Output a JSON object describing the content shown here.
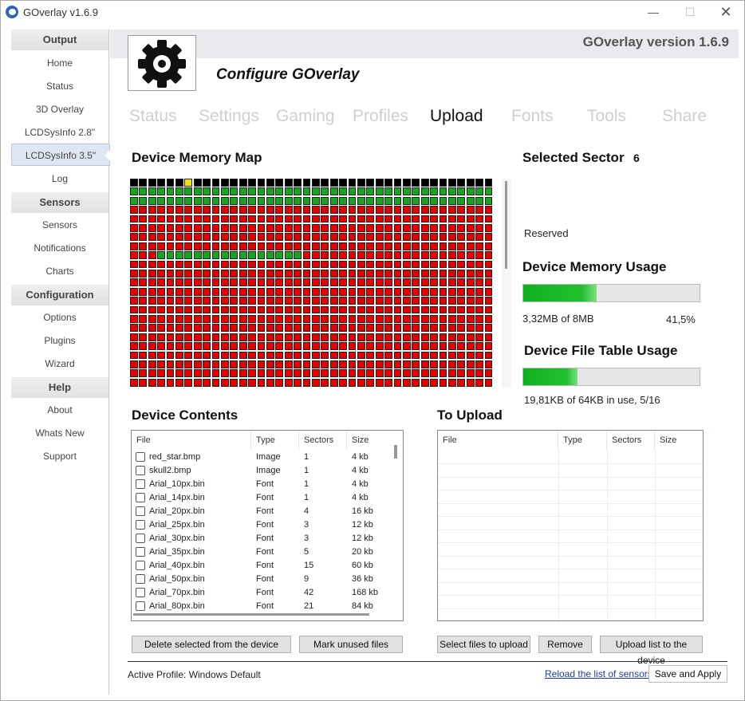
{
  "window": {
    "title": "GOverlay v1.6.9",
    "min_glyph": "—",
    "max_glyph": "☐",
    "close_glyph": "✕"
  },
  "sidebar": {
    "sections": [
      {
        "header": "Output",
        "items": [
          "Home",
          "Status",
          "3D Overlay",
          "LCDSysInfo 2.8\"",
          "LCDSysInfo 3.5\"",
          "Log"
        ]
      },
      {
        "header": "Sensors",
        "items": [
          "Sensors",
          "Notifications",
          "Charts"
        ]
      },
      {
        "header": "Configuration",
        "items": [
          "Options",
          "Plugins",
          "Wizard"
        ]
      },
      {
        "header": "Help",
        "items": [
          "About",
          "Whats New",
          "Support"
        ]
      }
    ],
    "active_item": "LCDSysInfo 3.5\""
  },
  "header": {
    "version": "GOverlay version 1.6.9",
    "configure": "Configure GOverlay",
    "logo_icon": "gear-icon"
  },
  "tabs": [
    {
      "label": "Status",
      "active": false
    },
    {
      "label": "Settings",
      "active": false
    },
    {
      "label": "Gaming",
      "active": false
    },
    {
      "label": "Profiles",
      "active": false
    },
    {
      "label": "Upload",
      "active": true
    },
    {
      "label": "Fonts",
      "active": false
    },
    {
      "label": "Tools",
      "active": false
    },
    {
      "label": "Share",
      "active": false
    }
  ],
  "memory_map": {
    "title": "Device Memory Map",
    "columns": 40,
    "rows_visible": 23,
    "colors": {
      "free": "#16a51d",
      "used": "#e60000",
      "reserved": "#000000",
      "selected": "#f2e600"
    },
    "row_states": [
      "KKKKKKKKKKKKKKKKKKKKKKKKKKKKKKKKKKKKKKKK",
      "GGGGGGGGGGGGGGGGGGGGGGGGGGGGGGGGGGGGGGGG",
      "GGGGGGGGGGGGGGGGGGGGGGGGGGGGGGGGGGGGGGGG",
      "RRRRRRRRRRRRRRRRRRRRRRRRRRRRRRRRRRRRRRRR",
      "RRRRRRRRRRRRRRRRRRRRRRRRRRRRRRRRRRRRRRRR",
      "RRRRRRRRRRRRRRRRRRRRRRRRRRRRRRRRRRRRRRRR",
      "RRRRRRRRRRRRRRRRRRRRRRRRRRRRRRRRRRRRRRRR",
      "RRRRRRRRRRRRRRRRRRRRRRRRRRRRRRRRRRRRRRRR",
      "RRRGGGGGGGGGGGGGGGGRRRRRRRRRRRRRRRRRRRRR",
      "RRRRRRRRRRRRRRRRRRRRRRRRRRRRRRRRRRRRRRRR"
    ]
  },
  "selected_sector": {
    "label": "Selected Sector",
    "value": "6",
    "status": "Reserved"
  },
  "memory_usage": {
    "title": "Device Memory Usage",
    "text": "3,32MB of 8MB",
    "percent_text": "41,5%",
    "fraction": 0.415
  },
  "file_table_usage": {
    "title": "Device File Table Usage",
    "text": "19,81KB of 64KB in use, 5/16",
    "fraction": 0.3095
  },
  "device_contents": {
    "title": "Device Contents",
    "columns": [
      "File",
      "Type",
      "Sectors",
      "Size"
    ],
    "rows": [
      {
        "file": "red_star.bmp",
        "type": "Image",
        "sectors": "1",
        "size": "4 kb"
      },
      {
        "file": "skull2.bmp",
        "type": "Image",
        "sectors": "1",
        "size": "4 kb"
      },
      {
        "file": "Arial_10px.bin",
        "type": "Font",
        "sectors": "1",
        "size": "4 kb"
      },
      {
        "file": "Arial_14px.bin",
        "type": "Font",
        "sectors": "1",
        "size": "4 kb"
      },
      {
        "file": "Arial_20px.bin",
        "type": "Font",
        "sectors": "4",
        "size": "16 kb"
      },
      {
        "file": "Arial_25px.bin",
        "type": "Font",
        "sectors": "3",
        "size": "12 kb"
      },
      {
        "file": "Arial_30px.bin",
        "type": "Font",
        "sectors": "3",
        "size": "12 kb"
      },
      {
        "file": "Arial_35px.bin",
        "type": "Font",
        "sectors": "5",
        "size": "20 kb"
      },
      {
        "file": "Arial_40px.bin",
        "type": "Font",
        "sectors": "15",
        "size": "60 kb"
      },
      {
        "file": "Arial_50px.bin",
        "type": "Font",
        "sectors": "9",
        "size": "36 kb"
      },
      {
        "file": "Arial_70px.bin",
        "type": "Font",
        "sectors": "42",
        "size": "168 kb"
      },
      {
        "file": "Arial_80px.bin",
        "type": "Font",
        "sectors": "21",
        "size": "84 kb"
      }
    ]
  },
  "to_upload": {
    "title": "To Upload",
    "columns": [
      "File",
      "Type",
      "Sectors",
      "Size"
    ]
  },
  "buttons": {
    "delete_selected": "Delete selected from the device",
    "mark_unused": "Mark unused files",
    "select_files": "Select files to upload",
    "remove": "Remove",
    "upload_list": "Upload list to the device",
    "save_apply": "Save and Apply"
  },
  "footer": {
    "active_profile": "Active Profile: Windows Default",
    "reload_link": "Reload the list of sensors"
  }
}
